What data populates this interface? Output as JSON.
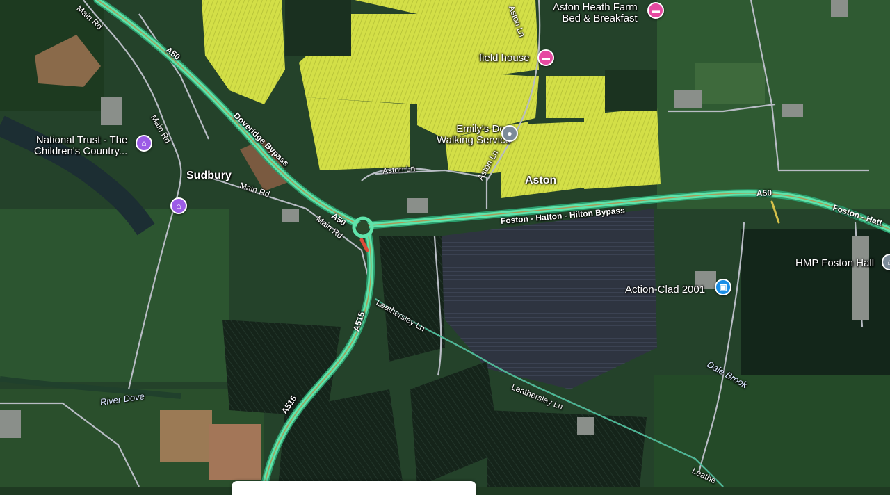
{
  "places": {
    "sudbury": "Sudbury",
    "aston": "Aston"
  },
  "pois": {
    "aston_heath_line1": "Aston Heath Farm",
    "aston_heath_line2": "Bed & Breakfast",
    "field_house": "field house",
    "emilys_line1": "Emily's Dog",
    "emilys_line2": "Walking Service",
    "national_trust_line1": "National Trust - The",
    "national_trust_line2": "Children's Country...",
    "hmp": "HMP Foston Hall",
    "action_clad": "Action-Clad 2001"
  },
  "roads": {
    "a50_nw": "A50",
    "doveridge": "Doveridge Bypass",
    "a50_mid": "A50",
    "foston": "Foston - Hatton - Hilton Bypass",
    "a50_east": "A50",
    "foston_east": "Foston - Hatt",
    "a515_upper": "A515",
    "a515_lower": "A515",
    "main_rd_1": "Main Rd",
    "main_rd_2": "Main Rd",
    "main_rd_3": "Main Rd",
    "main_rd_4": "Main Rd",
    "aston_ln_1": "Aston Ln",
    "aston_ln_2": "Aston Ln",
    "aston_ln_3": "Aston Ln",
    "leathersley_1": "Leathersley Ln",
    "leathersley_2": "Leathersley Ln",
    "leathersley_3": "Leathe"
  },
  "water": {
    "river_dove": "River Dove",
    "dale_brook": "Dale Brook"
  },
  "icons": {
    "hotel": "hotel-icon",
    "museum": "museum-icon",
    "service": "service-icon",
    "shop": "shop-icon",
    "gov": "government-icon"
  },
  "colors": {
    "highway": "#34c98a",
    "crop": "#d6e04a",
    "field_dark": "#16301a",
    "field_mid": "#2b4d2b",
    "hotel_pin": "#e64aa1",
    "museum_pin": "#9c5ce6",
    "shop_pin": "#1a8ee6"
  }
}
